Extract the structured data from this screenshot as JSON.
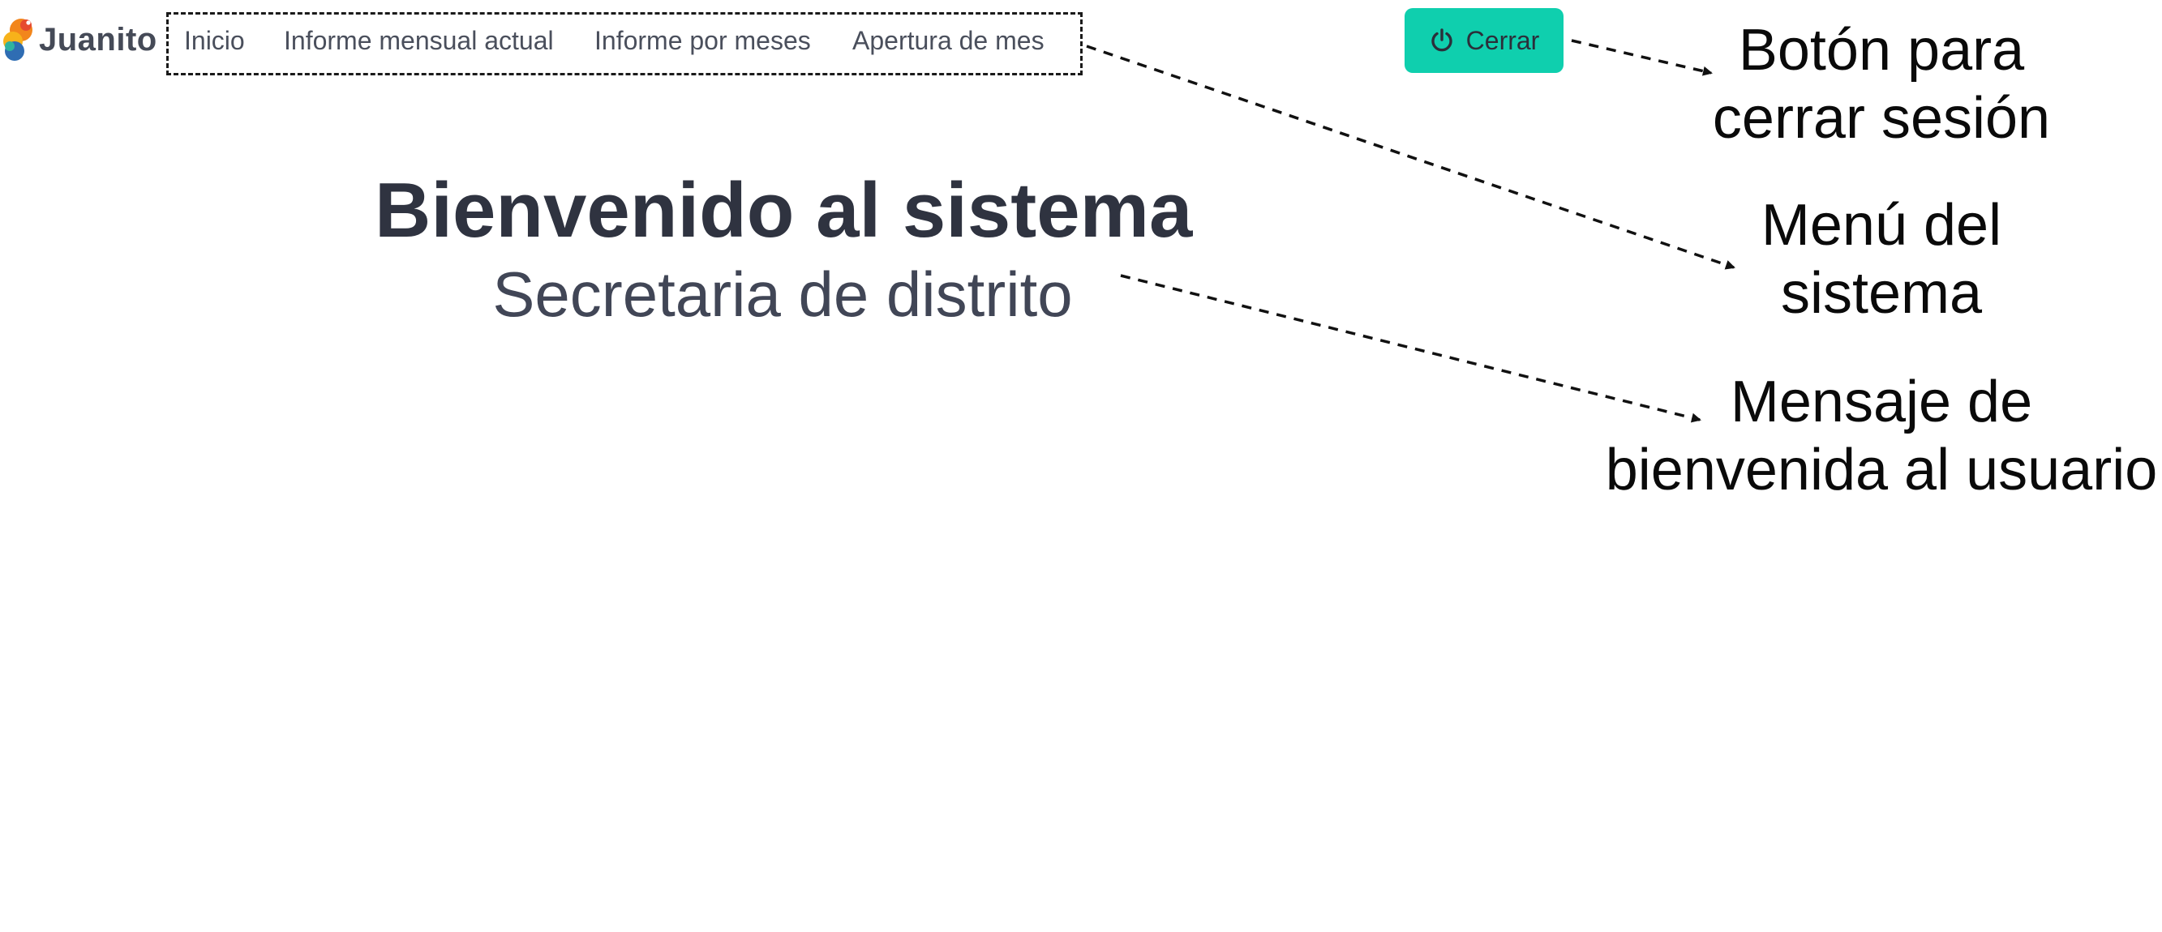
{
  "brand": {
    "name": "Juanito",
    "logo_colors": {
      "orange": "#f2861c",
      "red": "#e64b2f",
      "yellow": "#f7b21a",
      "blue": "#2f6db3",
      "teal": "#2fb3a0"
    }
  },
  "nav": {
    "items": [
      {
        "label": "Inicio"
      },
      {
        "label": "Informe mensual actual"
      },
      {
        "label": "Informe por meses"
      },
      {
        "label": "Apertura de mes"
      }
    ]
  },
  "header": {
    "logout_label": "Cerrar",
    "logout_icon": "power-icon",
    "logout_color": "#0fcfae"
  },
  "welcome": {
    "title": "Bienvenido al sistema",
    "subtitle": "Secretaria de distrito"
  },
  "annotations": {
    "logout": {
      "line1": "Botón para",
      "line2": "cerrar sesión"
    },
    "menu": {
      "line1": "Menú del",
      "line2": "sistema"
    },
    "welcome": {
      "line1": "Mensaje de",
      "line2": "bienvenida al usuario"
    }
  }
}
